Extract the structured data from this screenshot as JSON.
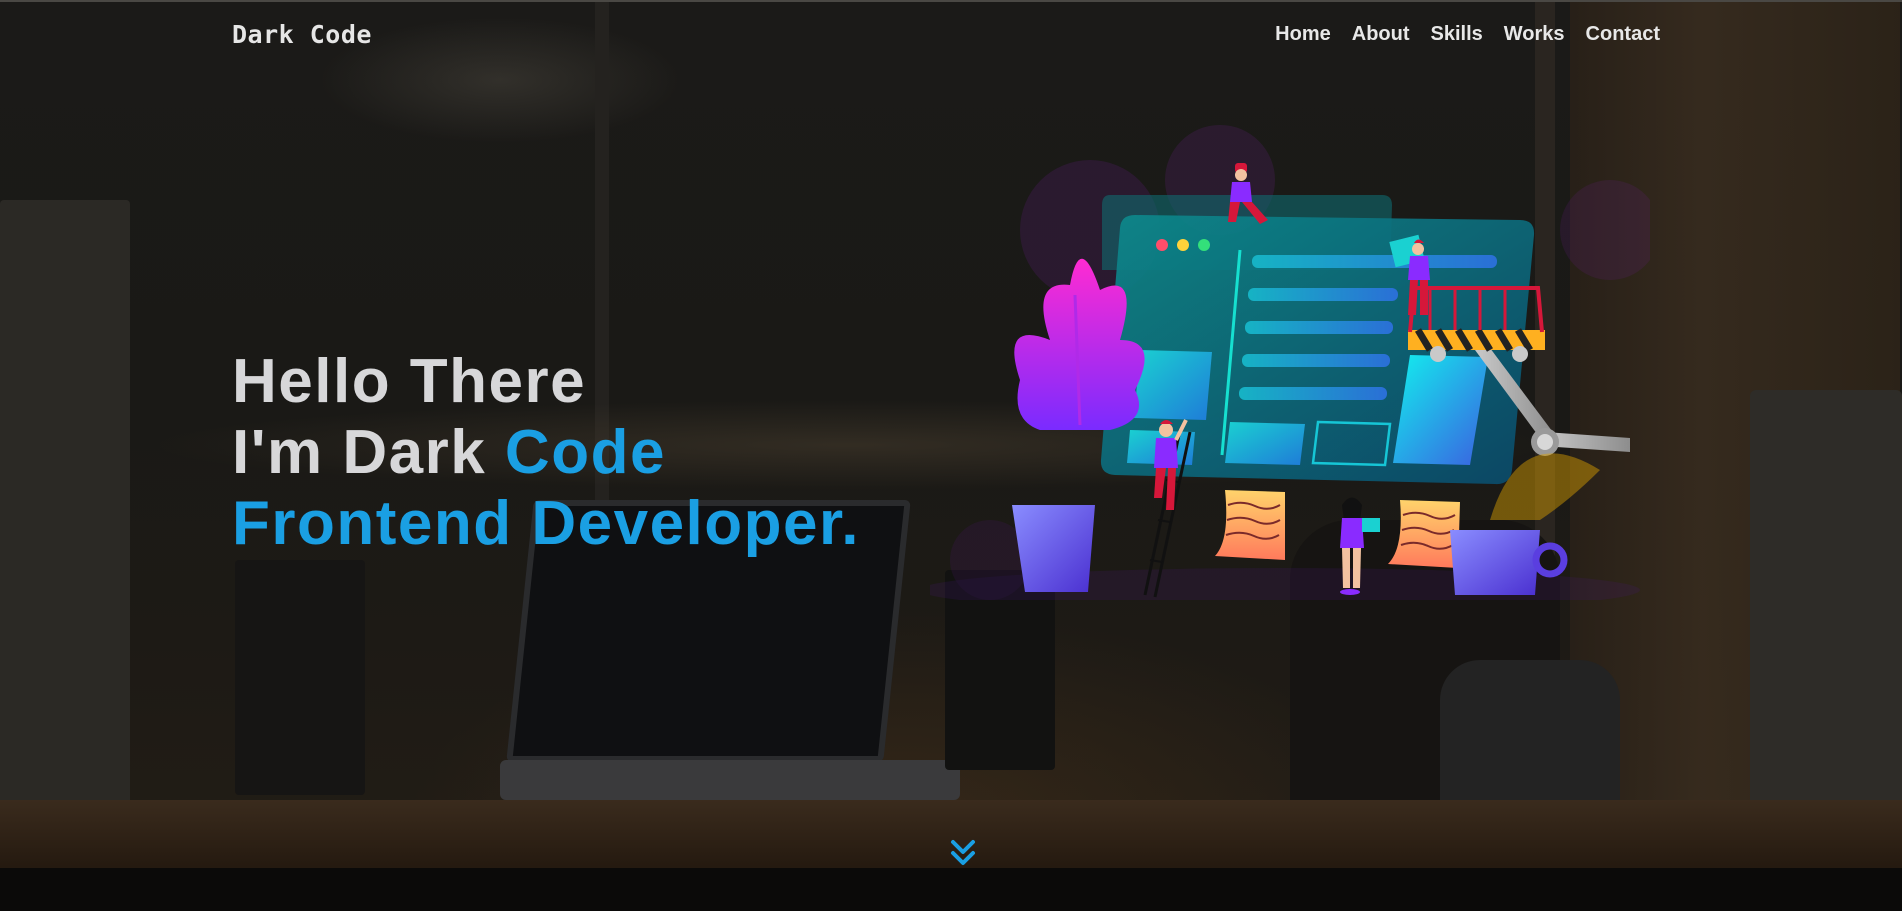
{
  "navbar": {
    "brand": "Dark Code",
    "links": [
      "Home",
      "About",
      "Skills",
      "Works",
      "Contact"
    ]
  },
  "hero": {
    "line1": "Hello There",
    "line2_prefix": "I'm Dark ",
    "line2_accent": "Code",
    "line3": "Frontend Developer."
  },
  "colors": {
    "accent": "#1a9fe3",
    "headline_text": "#d7d7d9",
    "nav_text": "#e8e8e8",
    "background": "#141210"
  },
  "icons": {
    "scroll_down": "double-chevron-down-icon"
  }
}
